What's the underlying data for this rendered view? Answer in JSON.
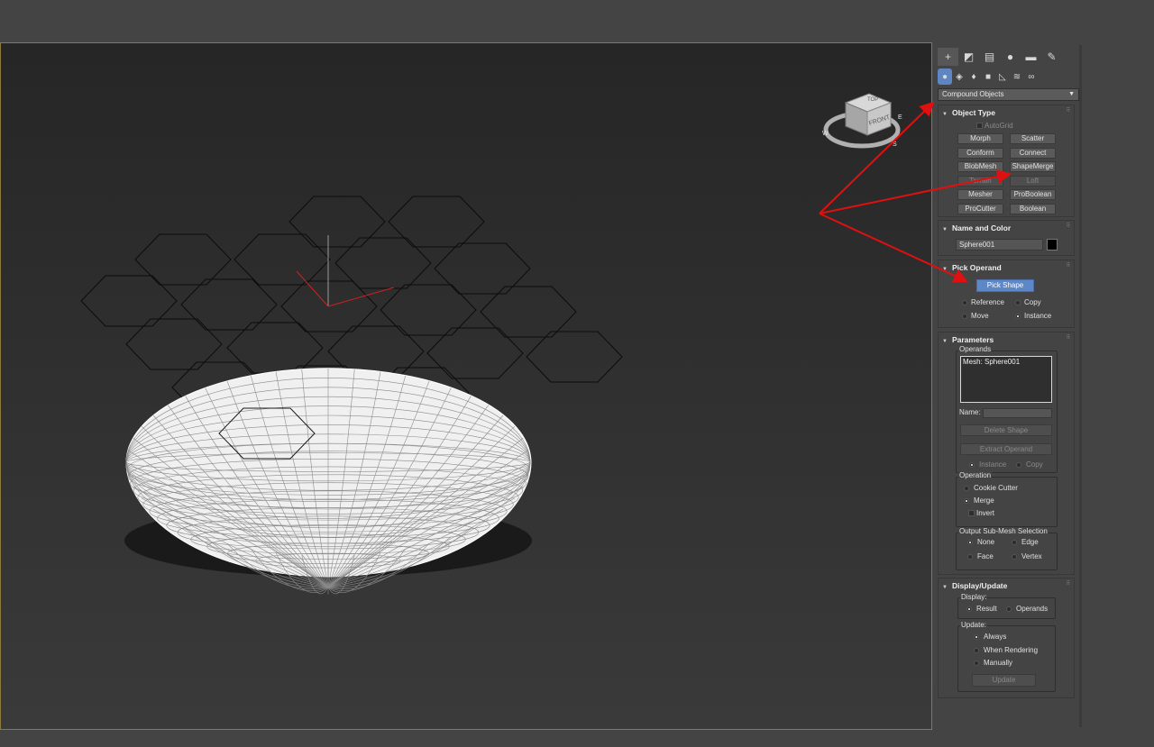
{
  "command_panel": {
    "category_dropdown": "Compound Objects",
    "object_type": {
      "title": "Object Type",
      "autogrid_label": "AutoGrid",
      "buttons": [
        "Morph",
        "Scatter",
        "Conform",
        "Connect",
        "BlobMesh",
        "ShapeMerge",
        "Terrain",
        "Loft",
        "Mesher",
        "ProBoolean",
        "ProCutter",
        "Boolean"
      ]
    },
    "name_color": {
      "title": "Name and Color",
      "name_value": "Sphere001",
      "color": "#000000"
    },
    "pick_operand": {
      "title": "Pick Operand",
      "pick_button": "Pick Shape",
      "reference_label": "Reference",
      "copy_label": "Copy",
      "move_label": "Move",
      "instance_label": "Instance",
      "selected": "Instance"
    },
    "parameters": {
      "title": "Parameters",
      "operands_label": "Operands",
      "operands_list": [
        "Mesh: Sphere001"
      ],
      "name_label": "Name:",
      "delete_shape": "Delete Shape",
      "extract_operand": "Extract Operand",
      "instance_label": "Instance",
      "copy_label": "Copy",
      "operation_label": "Operation",
      "cookie_cutter_label": "Cookie Cutter",
      "merge_label": "Merge",
      "invert_label": "Invert",
      "operation_selected": "Merge",
      "output_label": "Output Sub-Mesh Selection",
      "none_label": "None",
      "edge_label": "Edge",
      "face_label": "Face",
      "vertex_label": "Vertex",
      "output_selected": "None"
    },
    "display_update": {
      "title": "Display/Update",
      "display_label": "Display:",
      "result_label": "Result",
      "operands_label": "Operands",
      "display_selected": "Result",
      "update_label": "Update:",
      "always_label": "Always",
      "when_rendering_label": "When Rendering",
      "manually_label": "Manually",
      "update_selected": "Always",
      "update_button": "Update"
    }
  },
  "viewcube": {
    "top_label": "TOP",
    "front_label": "FRONT",
    "w_label": "W",
    "s_label": "S",
    "e_label": "E"
  },
  "colors": {
    "viewport_border": "#8d7a3d",
    "accent_button": "#5d87c6",
    "annotation_arrow": "#e01010"
  }
}
